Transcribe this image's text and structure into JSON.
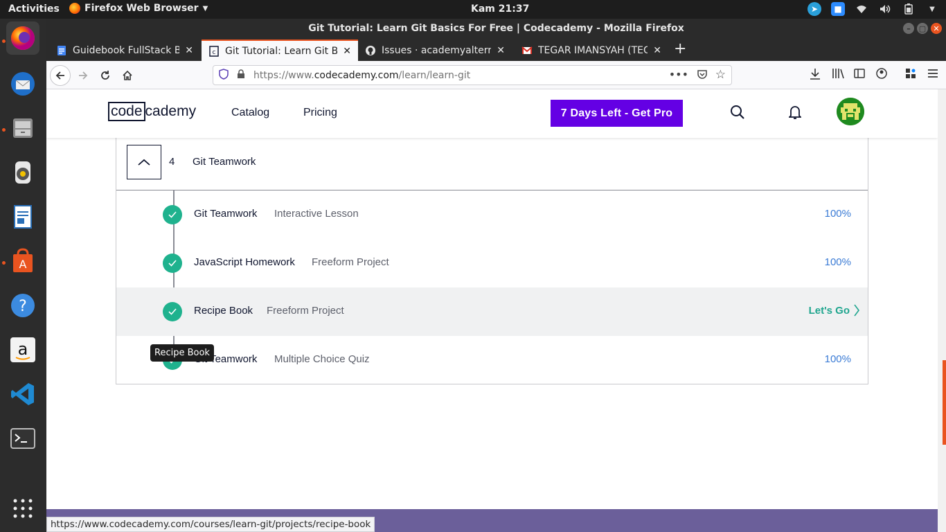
{
  "topbar": {
    "activities": "Activities",
    "app_menu": "Firefox Web Browser",
    "clock": "Kam 21:37"
  },
  "window": {
    "title": "Git Tutorial: Learn Git Basics For Free | Codecademy - Mozilla Firefox"
  },
  "tabs": [
    {
      "title": "Guidebook FullStack Bat",
      "icon": "google-docs-icon"
    },
    {
      "title": "Git Tutorial: Learn Git Ba",
      "icon": "codecademy-icon"
    },
    {
      "title": "Issues · academyalterra/",
      "icon": "github-icon"
    },
    {
      "title": "TEGAR IMANSYAH (TEGA",
      "icon": "gmail-icon"
    }
  ],
  "urlbar": {
    "scheme": "https://www.",
    "host": "codecademy.com",
    "path": "/learn/learn-git"
  },
  "site": {
    "logo_part1": "code",
    "logo_part2": "cademy",
    "nav": [
      "Catalog",
      "Pricing"
    ],
    "pro_button": "7 Days Left - Get Pro"
  },
  "module": {
    "number": "4",
    "title": "Git Teamwork",
    "items": [
      {
        "name": "Git Teamwork",
        "type": "Interactive Lesson",
        "status": "100%"
      },
      {
        "name": "JavaScript Homework",
        "type": "Freeform Project",
        "status": "100%"
      },
      {
        "name": "Recipe Book",
        "type": "Freeform Project",
        "status": "Let's Go"
      },
      {
        "name": "Git Teamwork",
        "type": "Multiple Choice Quiz",
        "status": "100%"
      }
    ]
  },
  "tooltip": "Recipe Book",
  "status_url": "https://www.codecademy.com/courses/learn-git/projects/recipe-book",
  "colors": {
    "accent": "#e95420",
    "pro": "#6400e4",
    "check": "#1fb28e",
    "percent": "#3a7bd5",
    "lets_go": "#1fa58e"
  }
}
